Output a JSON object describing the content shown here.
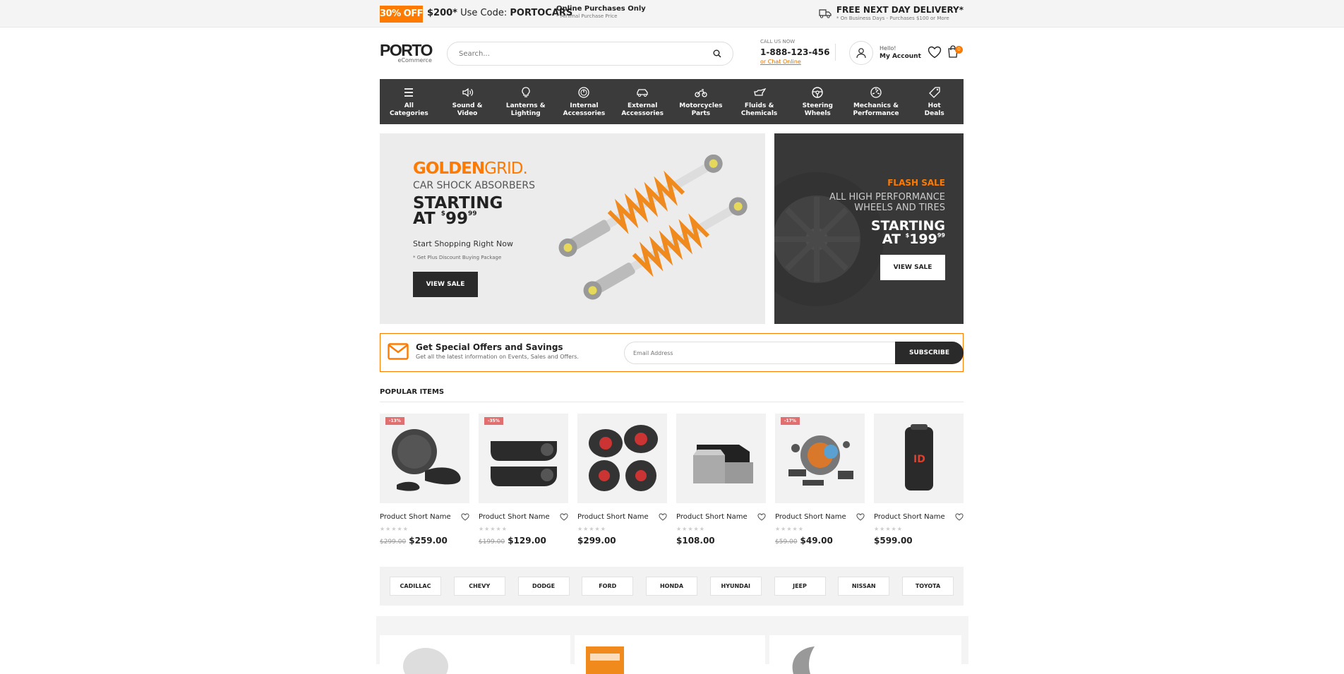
{
  "topbar": {
    "badge": "30% OFF",
    "promo_amount": "$200*",
    "promo_text": "Use Code:",
    "promo_code": "PORTOCARS",
    "note_title": "Online Purchases Only",
    "note_sub": "* Minimal Purchase Price",
    "delivery_title": "FREE NEXT DAY DELIVERY*",
    "delivery_sub": "* On Business Days - Purchases $100 or More"
  },
  "header": {
    "logo": "PORTO",
    "logo_sub": "eCommerce",
    "search_placeholder": "Search...",
    "call_label": "CALL US NOW",
    "phone": "1-888-123-456",
    "chat": "or Chat Online",
    "hello": "Hello!",
    "account": "My Account",
    "cart_count": "0"
  },
  "categories": [
    {
      "label1": "All",
      "label2": "Categories",
      "icon": "menu-icon"
    },
    {
      "label1": "Sound &",
      "label2": "Video",
      "icon": "speaker-icon"
    },
    {
      "label1": "Lanterns &",
      "label2": "Lighting",
      "icon": "bulb-icon"
    },
    {
      "label1": "Internal",
      "label2": "Accessories",
      "icon": "gauge-icon"
    },
    {
      "label1": "External",
      "label2": "Accessories",
      "icon": "car-icon"
    },
    {
      "label1": "Motorcycles",
      "label2": "Parts",
      "icon": "motorcycle-icon"
    },
    {
      "label1": "Fluids &",
      "label2": "Chemicals",
      "icon": "oil-can-icon"
    },
    {
      "label1": "Steering",
      "label2": "Wheels",
      "icon": "steering-wheel-icon"
    },
    {
      "label1": "Mechanics &",
      "label2": "Performance",
      "icon": "engine-icon"
    },
    {
      "label1": "Hot",
      "label2": "Deals",
      "icon": "tag-icon"
    }
  ],
  "banner_main": {
    "brand_bold": "GOLDEN",
    "brand_light": "GRID.",
    "subtitle": "CAR SHOCK ABSORBERS",
    "starting": "STARTING",
    "at": "AT",
    "currency": "$",
    "price": "99",
    "cents": "99",
    "cta_text": "Start Shopping Right Now",
    "note": "* Get Plus Discount Buying Package",
    "button": "VIEW SALE"
  },
  "banner_side": {
    "flash": "FLASH SALE",
    "line1": "ALL HIGH PERFORMANCE",
    "line2": "WHEELS AND TIRES",
    "starting": "STARTING",
    "at": "AT",
    "currency": "$",
    "price": "199",
    "cents": "99",
    "button": "VIEW SALE"
  },
  "newsletter": {
    "title": "Get Special Offers and Savings",
    "subtitle": "Get all the latest information on Events, Sales and Offers.",
    "placeholder": "Email Address",
    "button": "SUBSCRIBE"
  },
  "popular": {
    "title": "POPULAR ITEMS",
    "items": [
      {
        "name": "Product Short Name",
        "discount": "-13%",
        "old_price": "$299.00",
        "price": "$259.00",
        "stars": "★★★★★"
      },
      {
        "name": "Product Short Name",
        "discount": "-35%",
        "old_price": "$199.00",
        "price": "$129.00",
        "stars": "★★★★★"
      },
      {
        "name": "Product Short Name",
        "discount": "",
        "old_price": "",
        "price": "$299.00",
        "stars": "★★★★★"
      },
      {
        "name": "Product Short Name",
        "discount": "",
        "old_price": "",
        "price": "$108.00",
        "stars": "★★★★★"
      },
      {
        "name": "Product Short Name",
        "discount": "-17%",
        "old_price": "$59.00",
        "price": "$49.00",
        "stars": "★★★★★"
      },
      {
        "name": "Product Short Name",
        "discount": "",
        "old_price": "",
        "price": "$599.00",
        "stars": "★★★★★"
      }
    ]
  },
  "brands": [
    "CADILLAC",
    "CHEVY",
    "DODGE",
    "FORD",
    "HONDA",
    "HYUNDAI",
    "JEEP",
    "NISSAN",
    "TOYOTA"
  ],
  "colors": {
    "accent": "#ff7a00",
    "dark": "#3b3b3b",
    "sale": "#e07070"
  }
}
